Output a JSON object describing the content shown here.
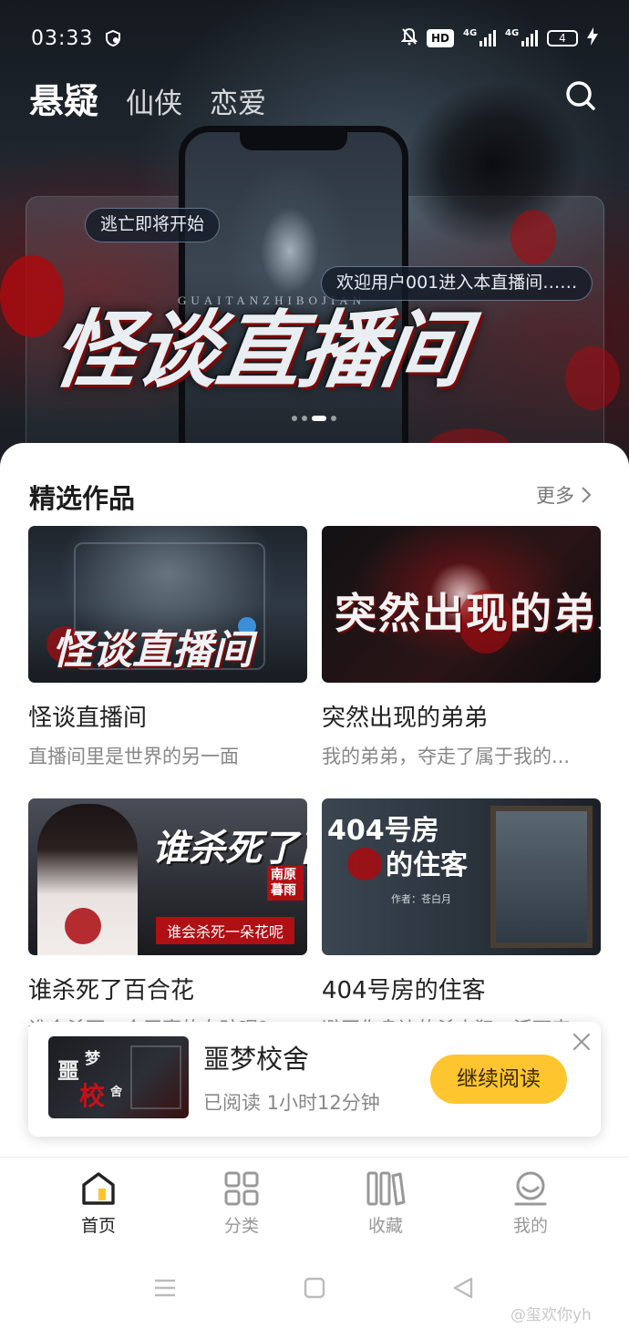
{
  "status_bar": {
    "time": "03:33",
    "hd_label": "HD",
    "network_1": "4G",
    "network_2": "4G",
    "battery": "4"
  },
  "category_tabs": [
    {
      "label": "悬疑",
      "active": true
    },
    {
      "label": "仙侠",
      "active": false
    },
    {
      "label": "恋爱",
      "active": false
    }
  ],
  "banner": {
    "title": "怪谈直播间",
    "subtitle": "GUAITANZHIBOJIAN",
    "bubble_1": "逃亡即将开始",
    "bubble_2": "欢迎用户001进入本直播间……",
    "page_count": 4,
    "active_page": 2
  },
  "featured": {
    "title": "精选作品",
    "more_label": "更多",
    "books": [
      {
        "title": "怪谈直播间",
        "description": "直播间里是世界的另一面",
        "cover_text": "怪谈直播间"
      },
      {
        "title": "突然出现的弟弟",
        "description": "我的弟弟，夺走了属于我的...",
        "cover_text": "突然出现的弟弟"
      },
      {
        "title": "谁杀死了百合花",
        "description": "谁会杀死一个无辜的女孩呢？",
        "cover_text": "谁杀死了百合花",
        "cover_author": "南原暮雨",
        "cover_tagline": "谁会杀死一朵花呢"
      },
      {
        "title": "404号房的住客",
        "description": "避开你身边的杀人犯，活下来",
        "cover_text_1": "404号房",
        "cover_text_2": "的住客",
        "cover_author": "作者：苍白月"
      }
    ]
  },
  "continue_reading": {
    "title": "噩梦校舍",
    "progress": "已阅读 1小时12分钟",
    "button_label": "继续阅读",
    "cover_text_1": "噩",
    "cover_text_2": "梦",
    "cover_text_3": "校",
    "cover_text_4": "舍"
  },
  "bottom_nav": [
    {
      "label": "首页",
      "icon": "home-icon",
      "active": true
    },
    {
      "label": "分类",
      "icon": "category-grid-icon",
      "active": false
    },
    {
      "label": "收藏",
      "icon": "bookshelf-icon",
      "active": false
    },
    {
      "label": "我的",
      "icon": "profile-icon",
      "active": false
    }
  ],
  "watermark": "@玺欢你yh",
  "colors": {
    "accent": "#ffc52e",
    "blood_red": "#a80a0f"
  }
}
